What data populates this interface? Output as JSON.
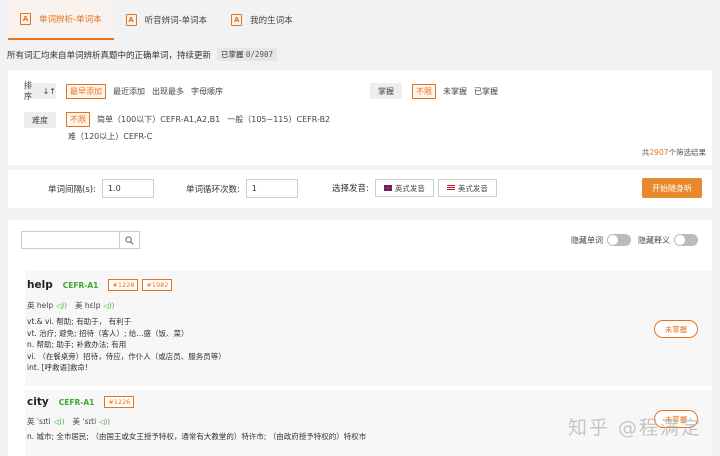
{
  "tabs": [
    {
      "label": "单词辨析-单词本",
      "icon": "A"
    },
    {
      "label": "听音辨词-单词本",
      "icon": "A"
    },
    {
      "label": "我的生词本",
      "icon": "A"
    }
  ],
  "description": {
    "text": "所有词汇均来自单词辨析真题中的正确单词，持续更新",
    "badge_label": "已掌握",
    "badge_count": "0/2907"
  },
  "filters": {
    "sort": {
      "label": "排序",
      "arrow": "↓↑",
      "options": [
        "最早添加",
        "最近添加",
        "出现最多",
        "字母顺序"
      ]
    },
    "mastery": {
      "label": "掌握",
      "options": [
        "不限",
        "未掌握",
        "已掌握"
      ]
    },
    "difficulty": {
      "label": "难度",
      "options": [
        "不限",
        "简单（100以下）CEFR-A1,A2,B1",
        "一般（105~115）CEFR-B2",
        "难（120以上）CEFR-C"
      ]
    },
    "total": {
      "prefix": "共",
      "count": "2907",
      "suffix": "个筛选结果"
    }
  },
  "settings": {
    "interval_label": "单词间隔(s):",
    "interval_value": "1.0",
    "loop_label": "单词循环次数:",
    "loop_value": "1",
    "voice_label": "选择发音:",
    "uk_label": "英式发音",
    "us_label": "美式发音",
    "start_label": "开始随身听"
  },
  "list": {
    "search_icon": "magnifier-icon",
    "hide_word_label": "隐藏单词",
    "hide_def_label": "隐藏释义",
    "words": [
      {
        "word": "help",
        "cefr": "CEFR-A1",
        "tags": [
          "#1228",
          "#1982"
        ],
        "uk_label": "英",
        "uk_phonetic": "help",
        "us_label": "美",
        "us_phonetic": "hɛlp",
        "definitions": [
          "vt.& vi. 帮助; 有助于，  有利于",
          "vt. 治疗; 避免; 招待（客人）; 给...盛（饭、菜）",
          "n. 帮助; 助手; 补救办法; 有用",
          "vi. （在餐桌旁）招待，侍应，作仆人（或店员、服务员等）",
          "int. [呼救语]救命!"
        ],
        "status": "未掌握"
      },
      {
        "word": "city",
        "cefr": "CEFR-A1",
        "tags": [
          "#1226"
        ],
        "uk_label": "英",
        "uk_phonetic": "ˈsɪti",
        "us_label": "美",
        "us_phonetic": "ˈsɪti",
        "definitions": [
          "n. 城市; 全市居民; （由国王或女王授予特权，通常有大教堂的）特许市; （由政府授予特权的）特权市"
        ],
        "status": "未掌握"
      }
    ]
  },
  "watermark": "知乎 @程满定"
}
